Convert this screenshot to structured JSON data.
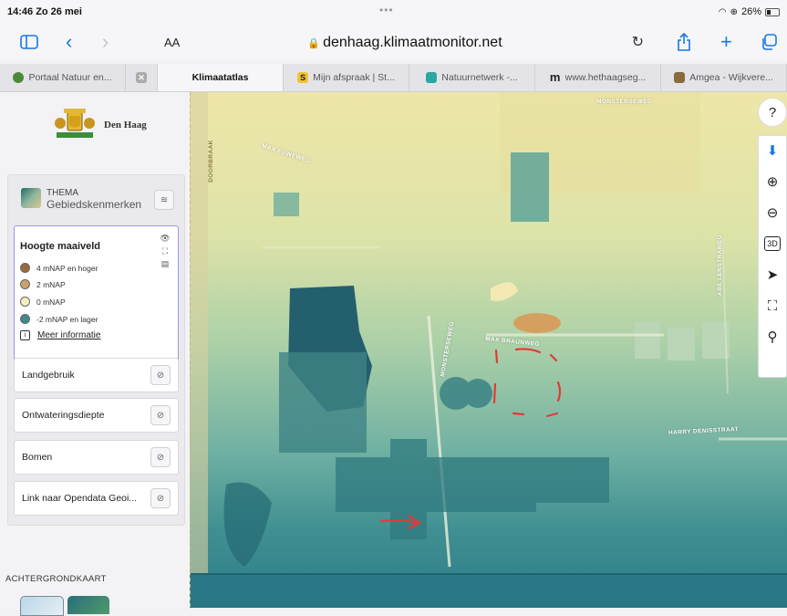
{
  "status": {
    "time_date": "14:46  Zo 26 mei",
    "battery": "26%",
    "dots": "•••"
  },
  "toolbar": {
    "text_size": "AA",
    "url": "denhaag.klimaatmonitor.net"
  },
  "tabs": [
    {
      "label": "Portaal Natuur en...",
      "icon": "green-globe-favicon",
      "color": "#4b8a3a",
      "letter": ""
    },
    {
      "label": "",
      "icon": "close-tab-icon",
      "color": "#aaaaaa",
      "letter": ""
    },
    {
      "label": "Klimaatatlas",
      "icon": "",
      "color": "",
      "letter": ""
    },
    {
      "label": "Mijn afspraak | St...",
      "icon": "s-favicon",
      "color": "#f1c232",
      "letter": "S"
    },
    {
      "label": "Natuurnetwerk -...",
      "icon": "app-favicon",
      "color": "#2aa7a0",
      "letter": ""
    },
    {
      "label": "www.hethaagseg...",
      "icon": "m-favicon",
      "color": "#222222",
      "letter": "m"
    },
    {
      "label": "Amgea - Wijkvere...",
      "icon": "folder-favicon",
      "color": "#8a6a3a",
      "letter": ""
    }
  ],
  "sidebar": {
    "logo_text": "Den Haag",
    "thema_label": "THEMA",
    "thema_value": "Gebiedskenmerken",
    "active_layer": {
      "title": "Hoogte maaiveld",
      "legend": [
        {
          "label": "4 mNAP en hoger",
          "color": "#9a6a3d"
        },
        {
          "label": "2 mNAP",
          "color": "#c9a36a"
        },
        {
          "label": "0 mNAP",
          "color": "#f6f0c2"
        },
        {
          "label": "-2 mNAP en lager",
          "color": "#3f8a8e"
        }
      ],
      "more_info": "Meer informatie"
    },
    "layers": [
      {
        "label": "Landgebruik"
      },
      {
        "label": "Ontwateringsdiepte"
      },
      {
        "label": "Bomen"
      },
      {
        "label": "Link naar Opendata Geoi..."
      }
    ],
    "basemap_label": "ACHTERGRONDKAART"
  },
  "map": {
    "streets": {
      "monsterseweg_top": "MONSTERSEWEG",
      "max_euweweg": "MAX EUWEWEG",
      "doorbraak": "DOORBRAAK",
      "monsterseweg": "MONSTERSEWEG",
      "max_braunweg": "MAX BRAUNWEG",
      "abe_lenstraweg": "ABE LENSTRAWEG",
      "harry": "HARRY DENISSTRAAT"
    }
  },
  "controls": [
    "help-icon",
    "download-icon",
    "zoom-in-icon",
    "zoom-out-icon",
    "3d-button",
    "north-arrow-icon",
    "fullscreen-icon",
    "location-pin-icon"
  ],
  "controls_text": {
    "help": "?",
    "three_d": "3D"
  }
}
